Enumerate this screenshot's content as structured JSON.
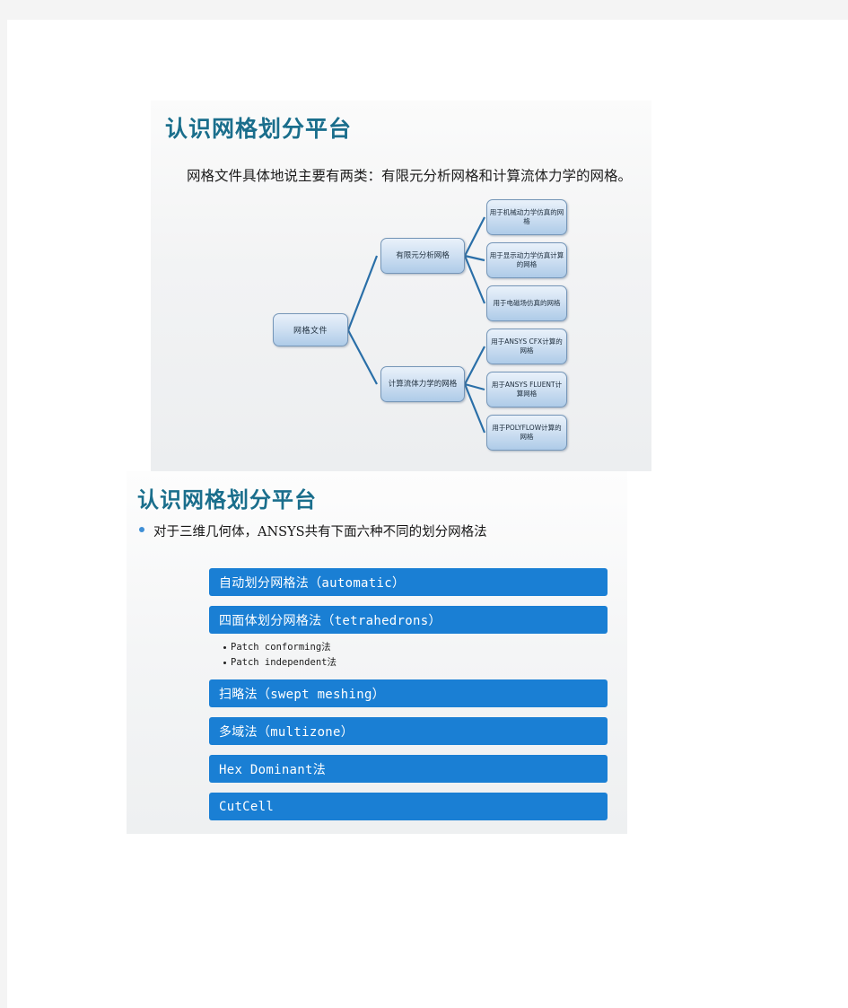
{
  "slide_one": {
    "title": "认识网格划分平台",
    "body": "网格文件具体地说主要有两类：有限元分析网格和计算流体力学的网格。",
    "diagram": {
      "root": "网格文件",
      "branches": [
        {
          "label": "有限元分析网格",
          "children": [
            "用于机械动力学仿真的网格",
            "用于显示动力学仿真计算的网格",
            "用于电磁场仿真的网格"
          ]
        },
        {
          "label": "计算流体力学的网格",
          "children": [
            "用于ANSYS CFX计算的网格",
            "用于ANSYS FLUENT计算网格",
            "用于POLYFLOW计算的网格"
          ]
        }
      ]
    }
  },
  "slide_two": {
    "title": "认识网格划分平台",
    "bullet": "对于三维几何体，ANSYS共有下面六种不同的划分网格法",
    "methods": [
      {
        "label": "自动划分网格法（automatic）",
        "sub": []
      },
      {
        "label": "四面体划分网格法（tetrahedrons）",
        "sub": [
          "Patch conforming法",
          "Patch independent法"
        ]
      },
      {
        "label": "扫略法（swept meshing）",
        "sub": []
      },
      {
        "label": "多域法（multizone）",
        "sub": []
      },
      {
        "label": "Hex Dominant法",
        "sub": []
      },
      {
        "label": "CutCell",
        "sub": []
      }
    ]
  },
  "colors": {
    "title_teal": "#1a6e8c",
    "bar_blue": "#1a7fd4",
    "bullet_blue": "#3f8fd6",
    "node_border": "#7596b8",
    "connector": "#2a6fa8",
    "page_backdrop": "#f4f4f4"
  }
}
